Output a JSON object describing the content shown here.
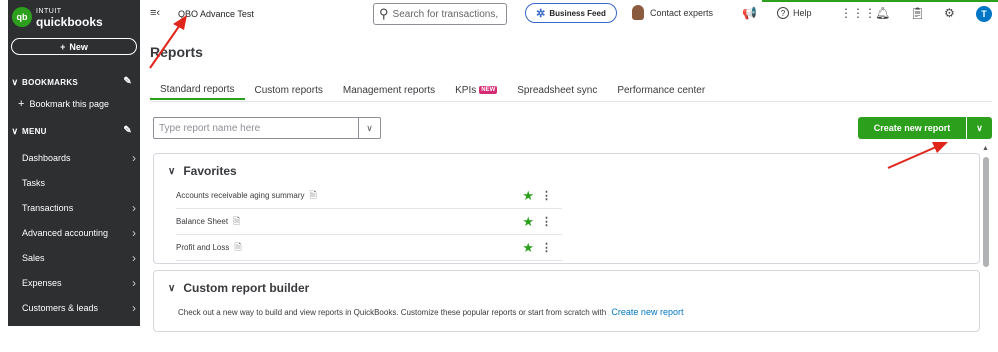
{
  "sidebar": {
    "logo_intuit": "INTUIT",
    "logo_name": "quickbooks",
    "logo_mark": "qb",
    "new_label": "New",
    "bookmarks_label": "BOOKMARKS",
    "bookmark_page_label": "Bookmark this page",
    "menu_label": "MENU",
    "items": [
      {
        "label": "Dashboards",
        "arrow": true
      },
      {
        "label": "Tasks",
        "arrow": false
      },
      {
        "label": "Transactions",
        "arrow": true
      },
      {
        "label": "Advanced accounting",
        "arrow": true
      },
      {
        "label": "Sales",
        "arrow": true
      },
      {
        "label": "Expenses",
        "arrow": true
      },
      {
        "label": "Customers & leads",
        "arrow": true
      }
    ]
  },
  "topbar": {
    "company_name": "QBO Advance Test",
    "search_placeholder": "Search for transactions,",
    "business_feed": "Business Feed",
    "contact_experts": "Contact experts",
    "help": "Help",
    "user_initial": "T"
  },
  "main": {
    "title": "Reports",
    "tabs": [
      {
        "label": "Standard reports",
        "active": true
      },
      {
        "label": "Custom reports"
      },
      {
        "label": "Management reports"
      },
      {
        "label": "KPIs",
        "badge": "NEW"
      },
      {
        "label": "Spreadsheet sync"
      },
      {
        "label": "Performance center"
      }
    ],
    "report_search_placeholder": "Type report name here",
    "create_button": "Create new report",
    "favorites": {
      "title": "Favorites",
      "items": [
        {
          "label": "Accounts receivable aging summary"
        },
        {
          "label": "Balance Sheet"
        },
        {
          "label": "Profit and Loss"
        }
      ]
    },
    "custom_builder": {
      "title": "Custom report builder",
      "description": "Check out a new way to build and view reports in QuickBooks. Customize these popular reports or start from scratch with",
      "link": "Create new report"
    }
  },
  "colors": {
    "sidebar_bg": "#2d2f31",
    "brand_green": "#2ca01c",
    "link_blue": "#0077c5",
    "badge_pink": "#d52b75",
    "annotation_red": "#e0251b"
  },
  "icons": [
    "hamburger-icon",
    "search-icon",
    "sparkle-icon",
    "megaphone-icon",
    "help-icon",
    "apps-grid-icon",
    "bell-icon",
    "clipboard-icon",
    "gear-icon",
    "chevron-down-icon",
    "star-icon",
    "kebab-icon",
    "document-icon",
    "pencil-icon",
    "plus-icon"
  ]
}
